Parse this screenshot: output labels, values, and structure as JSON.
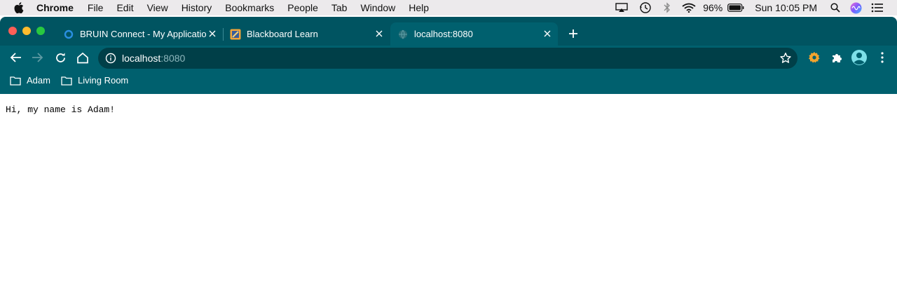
{
  "menubar": {
    "app_name": "Chrome",
    "menus": [
      "File",
      "Edit",
      "View",
      "History",
      "Bookmarks",
      "People",
      "Tab",
      "Window",
      "Help"
    ],
    "battery": "96%",
    "clock": "Sun 10:05 PM",
    "icons": [
      "apple-icon",
      "airplay-icon",
      "time-machine-icon",
      "bluetooth-icon",
      "wifi-icon",
      "battery-icon",
      "spotlight-icon",
      "siri-icon",
      "control-center-icon"
    ]
  },
  "tabs": [
    {
      "title": "BRUIN Connect - My Applicatio",
      "favicon": "ring-icon",
      "active": false
    },
    {
      "title": "Blackboard Learn",
      "favicon": "blackboard-icon",
      "active": false
    },
    {
      "title": "localhost:8080",
      "favicon": "globe-icon",
      "active": true
    }
  ],
  "omnibox": {
    "host": "localhost",
    "port": ":8080"
  },
  "bookmarks": [
    {
      "label": "Adam"
    },
    {
      "label": "Living Room"
    }
  ],
  "page": {
    "message": "Hi, my name is Adam!"
  },
  "colors": {
    "frame": "#005461",
    "toolbar": "#00606e",
    "omnibox": "#003f48",
    "accent": "#7ee0e9"
  }
}
